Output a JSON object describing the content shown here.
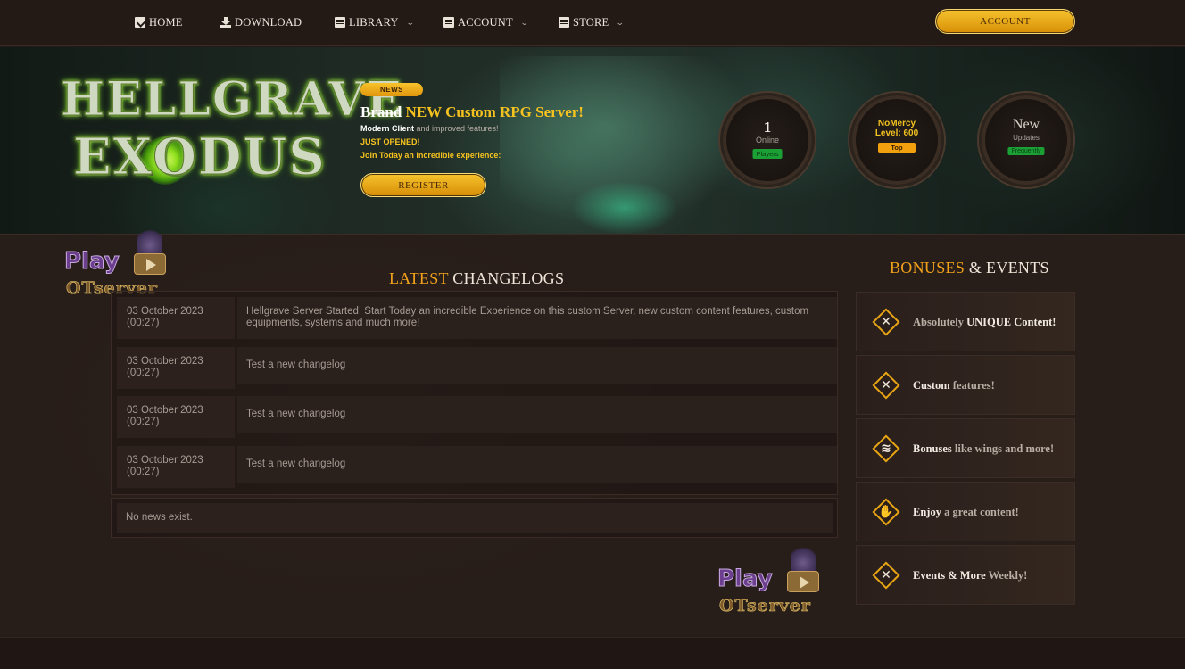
{
  "nav": {
    "items": [
      {
        "label": "HOME",
        "icon": "home-icon"
      },
      {
        "label": "DOWNLOAD",
        "icon": "download-icon"
      },
      {
        "label": "LIBRARY",
        "icon": "book-icon",
        "dropdown": true
      },
      {
        "label": "ACCOUNT",
        "icon": "book-icon",
        "dropdown": true
      },
      {
        "label": "STORE",
        "icon": "book-icon",
        "dropdown": true
      }
    ],
    "account_button": "ACCOUNT"
  },
  "hero": {
    "logo_line1": "HELLGRAVE",
    "logo_line2": "EXODUS",
    "badge": "NEWS",
    "title_prefix": "Brand ",
    "title_highlight": "NEW Custom RPG Server!",
    "line1_bold": "Modern Client",
    "line1_rest": " and improved features!",
    "line2": "JUST OPENED!",
    "line3": "Join Today an incredible experience:",
    "register_button": "REGISTER",
    "stats": [
      {
        "big": "1",
        "sub": "Online",
        "tag": "Players",
        "tag_color": "#1aa035"
      },
      {
        "big": "NoMercy",
        "sub": "Level: 600",
        "tag": "Top",
        "tag_color": "#f2a00e"
      },
      {
        "big": "New",
        "sub": "Updates",
        "tag": "Frequently",
        "tag_color": "#1aa035"
      }
    ]
  },
  "changelogs": {
    "title_accent": "LATEST",
    "title_rest": " CHANGELOGS",
    "rows": [
      {
        "date": "03 October 2023",
        "time": "(00:27)",
        "text": "Hellgrave Server Started! Start Today an incredible Experience on this custom Server, new custom content features, custom equipments, systems and much more!"
      },
      {
        "date": "03 October 2023",
        "time": "(00:27)",
        "text": "Test a new changelog"
      },
      {
        "date": "03 October 2023",
        "time": "(00:27)",
        "text": "Test a new changelog"
      },
      {
        "date": "03 October 2023",
        "time": "(00:27)",
        "text": "Test a new changelog"
      }
    ],
    "no_news": "No news exist."
  },
  "bonuses": {
    "title_accent": "BONUSES",
    "title_rest": " & EVENTS",
    "cards": [
      {
        "pre": "Absolutely ",
        "bold": "UNIQUE Content",
        "post": "!",
        "icon": "crossed-swords-icon"
      },
      {
        "pre": "",
        "bold": "Custom",
        "post": " features!",
        "icon": "crossed-swords-icon"
      },
      {
        "pre": "",
        "bold": "Bonuses",
        "post": " like wings and more!",
        "icon": "coins-icon"
      },
      {
        "pre": "",
        "bold": "Enjoy",
        "post": " a great content!",
        "icon": "thumbs-up-icon"
      },
      {
        "pre": "",
        "bold": "Events & More",
        "post": " Weekly!",
        "icon": "crossed-swords-icon"
      }
    ]
  },
  "watermark": {
    "line1": "Play",
    "line2": "OTserver"
  },
  "colors": {
    "accent": "#f2a21a",
    "gold": "#f5c21f",
    "background": "#271d19"
  }
}
